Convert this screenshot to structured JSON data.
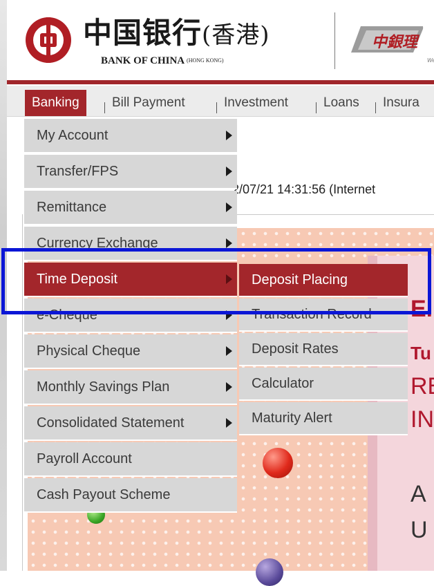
{
  "header": {
    "logo_chinese": "中国银行",
    "logo_chinese_suffix": "(香港)",
    "logo_english": "BANK OF CHINA",
    "logo_english_suffix": "(HONG KONG)",
    "partner_logo_text": "中銀理",
    "partner_logo_subtext": "Wealth Ma",
    "brand_color": "#a3262b"
  },
  "nav": {
    "tabs": [
      {
        "label": "Banking",
        "active": true
      },
      {
        "label": "Bill Payment",
        "active": false
      },
      {
        "label": "Investment",
        "active": false
      },
      {
        "label": "Loans",
        "active": false
      },
      {
        "label": "Insura",
        "active": false
      }
    ]
  },
  "page": {
    "timestamp": "2/07/21 14:31:56 (Internet"
  },
  "menu": {
    "items": [
      {
        "label": "My Account",
        "has_submenu": true,
        "active": false
      },
      {
        "label": "Transfer/FPS",
        "has_submenu": true,
        "active": false
      },
      {
        "label": "Remittance",
        "has_submenu": true,
        "active": false
      },
      {
        "label": "Currency Exchange",
        "has_submenu": true,
        "active": false
      },
      {
        "label": "Time Deposit",
        "has_submenu": true,
        "active": true
      },
      {
        "label": "e-Cheque",
        "has_submenu": true,
        "active": false
      },
      {
        "label": "Physical Cheque",
        "has_submenu": true,
        "active": false
      },
      {
        "label": "Monthly Savings Plan",
        "has_submenu": true,
        "active": false
      },
      {
        "label": "Consolidated Statement",
        "has_submenu": true,
        "active": false
      },
      {
        "label": "Payroll Account",
        "has_submenu": false,
        "active": false
      },
      {
        "label": "Cash Payout Scheme",
        "has_submenu": false,
        "active": false
      }
    ]
  },
  "submenu": {
    "items": [
      {
        "label": "Deposit Placing",
        "active": true
      },
      {
        "label": "Transaction Record",
        "active": false
      },
      {
        "label": "Deposit Rates",
        "active": false
      },
      {
        "label": "Calculator",
        "active": false
      },
      {
        "label": "Maturity Alert",
        "active": false
      }
    ]
  },
  "banner": {
    "lines": [
      "El",
      "Tu",
      "RE",
      "IN",
      "A",
      "U"
    ]
  },
  "colors": {
    "highlight": "#0b16d6",
    "menu_bg": "#d7d7d7"
  }
}
